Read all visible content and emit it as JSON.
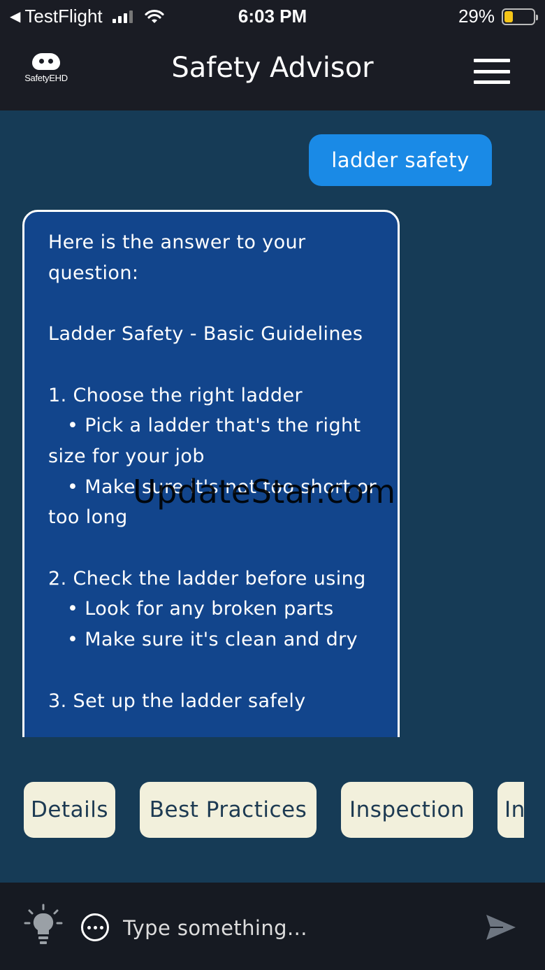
{
  "status_bar": {
    "carrier": "TestFlight",
    "time": "6:03 PM",
    "battery_percent": "29%",
    "battery_level": 0.29
  },
  "header": {
    "logo_text": "SafetyEHD",
    "title": "Safety Advisor"
  },
  "chat": {
    "user_message": "ladder safety",
    "bot_message": "Here is the answer to your question:\n\nLadder Safety - Basic Guidelines\n\n1. Choose the right ladder\n   • Pick a ladder that's the right size for your job\n   • Make sure it's not too short or too long\n\n2. Check the ladder before using\n   • Look for any broken parts\n   • Make sure it's clean and dry\n\n3. Set up the ladder safely"
  },
  "watermark": "UpdateStar.com",
  "suggestions": [
    "Details",
    "Best Practices",
    "Inspection",
    "In"
  ],
  "input": {
    "placeholder": "Type something..."
  },
  "colors": {
    "background": "#163b56",
    "bar": "#1a1c24",
    "user_bubble": "#1a8ae6",
    "bot_bubble": "#12458c",
    "chip": "#f2f0dc"
  }
}
